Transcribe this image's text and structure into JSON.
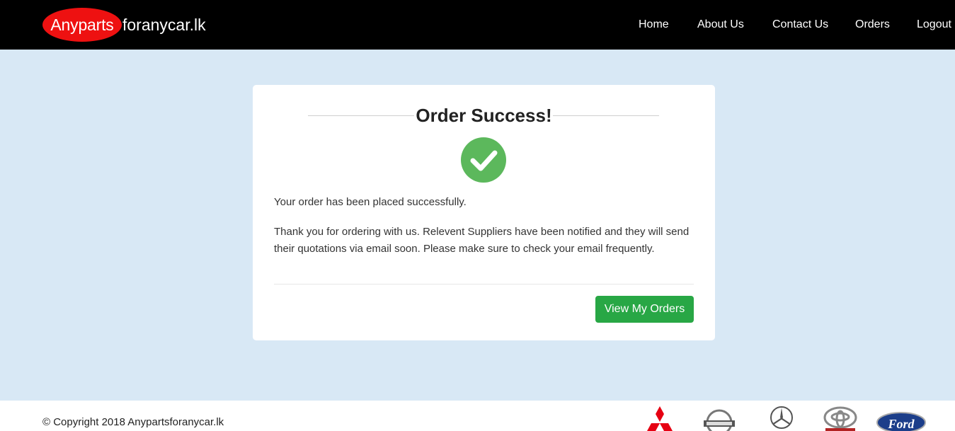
{
  "brand": {
    "highlight": "Anyparts",
    "rest": "foranycar.lk"
  },
  "nav": {
    "home": "Home",
    "about": "About Us",
    "contact": "Contact Us",
    "orders": "Orders",
    "logout": "Logout"
  },
  "card": {
    "title": "Order Success!",
    "message": "Your order has been placed successfully.",
    "details": "Thank you for ordering with us. Relevent Suppliers have been notified and they will send their quotations via email soon. Please make sure to check your email frequently.",
    "button": "View My Orders"
  },
  "footer": {
    "copyright": "© Copyright 2018 Anypartsforanycar.lk",
    "logos": [
      "mitsubishi-logo",
      "nissan-logo",
      "mercedes-logo",
      "toyota-logo",
      "ford-logo"
    ]
  },
  "colors": {
    "navbar": "#000000",
    "brand_oval": "#ee1111",
    "page_background": "#d8e8f5",
    "success": "#5cb85c",
    "button": "#28a745"
  }
}
